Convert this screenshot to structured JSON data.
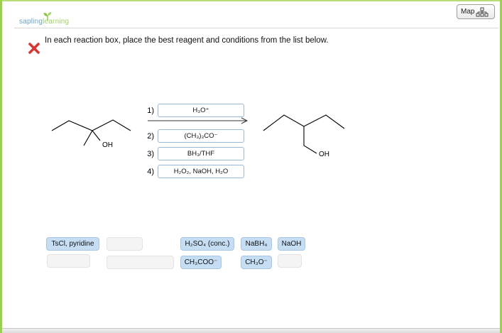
{
  "brand": {
    "part1": "sapling",
    "part2": "learning"
  },
  "map_button": {
    "label": "Map"
  },
  "question": {
    "instruction": "In each reaction box, place the best reagent and conditions from the list below.",
    "status": "incorrect",
    "reactant_label": "OH",
    "product_label": "OH"
  },
  "steps": [
    {
      "number": "1)",
      "reagent": "H₃O⁺"
    },
    {
      "number": "2)",
      "reagent": "(CH₃)₃CO⁻"
    },
    {
      "number": "3)",
      "reagent": "BH₃/THF"
    },
    {
      "number": "4)",
      "reagent": "H₂O₂, NaOH, H₂O"
    }
  ],
  "reagent_bank": {
    "row1": [
      "TsCl, pyridine",
      "",
      "H₂SO₄ (conc.)",
      "NaBH₄",
      "NaOH"
    ],
    "row2": [
      "",
      "",
      "CH₃COO⁻",
      "CH₃O⁻",
      ""
    ]
  },
  "colors": {
    "frame_accent": "#9bd24b",
    "chip_fill": "#c6def3",
    "drop_border": "#9bb8d4",
    "incorrect_mark": "#e03030"
  }
}
